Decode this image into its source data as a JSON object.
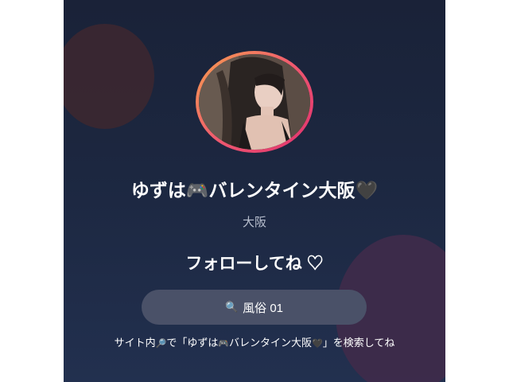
{
  "profile": {
    "name": "ゆずは",
    "name_emoji": "🎮",
    "shop": "バレンタイン大阪",
    "heart_emoji": "🖤",
    "location": "大阪",
    "avatar": "profile-photo"
  },
  "follow": {
    "label": "フォローしてね ♡"
  },
  "search": {
    "icon": "🔍",
    "keyword": "風俗 01"
  },
  "hint": {
    "prefix": "サイト内",
    "search_icon": "🔎",
    "middle": "で「",
    "name": "ゆずは",
    "name_emoji": "🎮",
    "shop": "バレンタイン大阪",
    "heart_emoji": "🖤",
    "suffix": "」を検索してね"
  },
  "colors": {
    "background_top": "#1a2238",
    "ring_start": "#f6a04d",
    "ring_end": "#e0306f",
    "pill": "#4a5168",
    "location_text": "#b9c0cf"
  }
}
